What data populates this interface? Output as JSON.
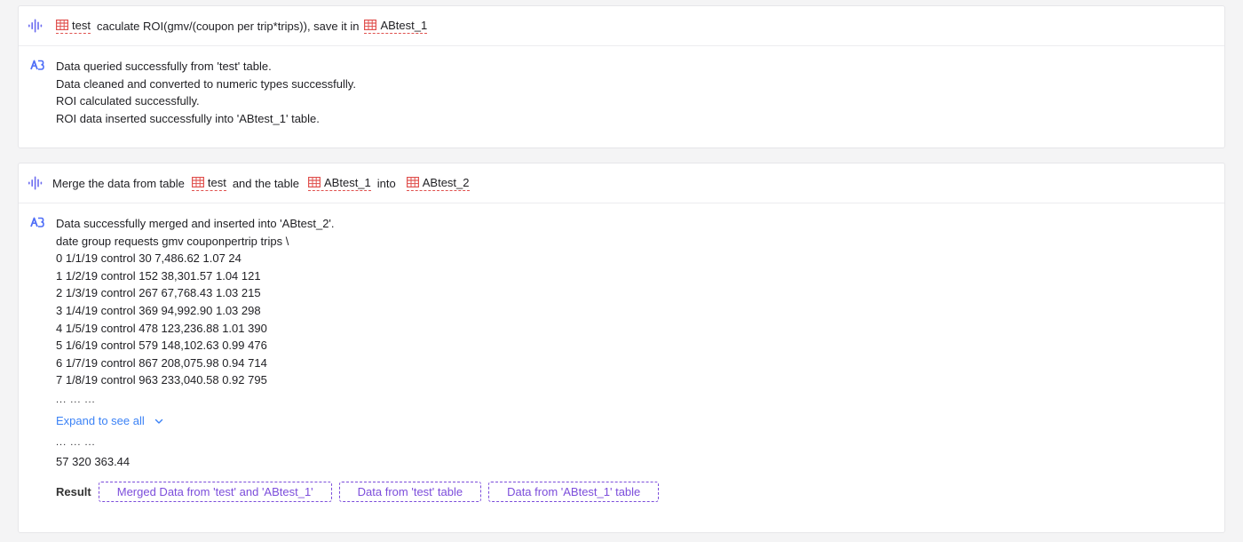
{
  "colors": {
    "accent_purple": "#7c4ddb",
    "link_blue": "#3b82f6",
    "table_icon_red": "#e0524f",
    "logo_blue": "#4f6ef7"
  },
  "conversations": [
    {
      "query": {
        "icon": "voice-wave-icon",
        "parts": [
          "",
          "caculate ROI(gmv/(coupon per trip*trips)), save it in"
        ],
        "tables": [
          "test",
          "ABtest_1"
        ]
      },
      "answer": {
        "icon": "assistant-logo-icon",
        "lines": [
          "Data queried successfully from 'test' table.",
          "Data cleaned and converted to numeric types successfully.",
          "ROI calculated successfully.",
          "ROI data inserted successfully into 'ABtest_1' table."
        ]
      }
    },
    {
      "query": {
        "icon": "voice-wave-icon",
        "parts": [
          "Merge the data from table",
          "and the table",
          "into"
        ],
        "tables": [
          "test",
          "ABtest_1",
          "ABtest_2"
        ]
      },
      "answer": {
        "icon": "assistant-logo-icon",
        "lines": [
          "Data successfully merged and inserted into 'ABtest_2'.",
          "date group requests gmv couponpertrip trips \\",
          "0 1/1/19 control 30 7,486.62 1.07 24",
          "1 1/2/19 control 152 38,301.57 1.04 121",
          "2 1/3/19 control 267 67,768.43 1.03 215",
          "3 1/4/19 control 369 94,992.90 1.03 298",
          "4 1/5/19 control 478 123,236.88 1.01 390",
          "5 1/6/19 control 579 148,102.63 0.99 476",
          "6 1/7/19 control 867 208,075.98 0.94 714",
          "7 1/8/19 control 963 233,040.58 0.92 795"
        ],
        "ellipsis": "... ... ...",
        "expand_label": "Expand to see all",
        "after_ellipsis": "... ... ...",
        "tail_line": "57 320 363.44",
        "result_label": "Result",
        "result_buttons": [
          "Merged Data from 'test' and 'ABtest_1'",
          "Data from 'test' table",
          "Data from 'ABtest_1' table"
        ]
      }
    }
  ]
}
